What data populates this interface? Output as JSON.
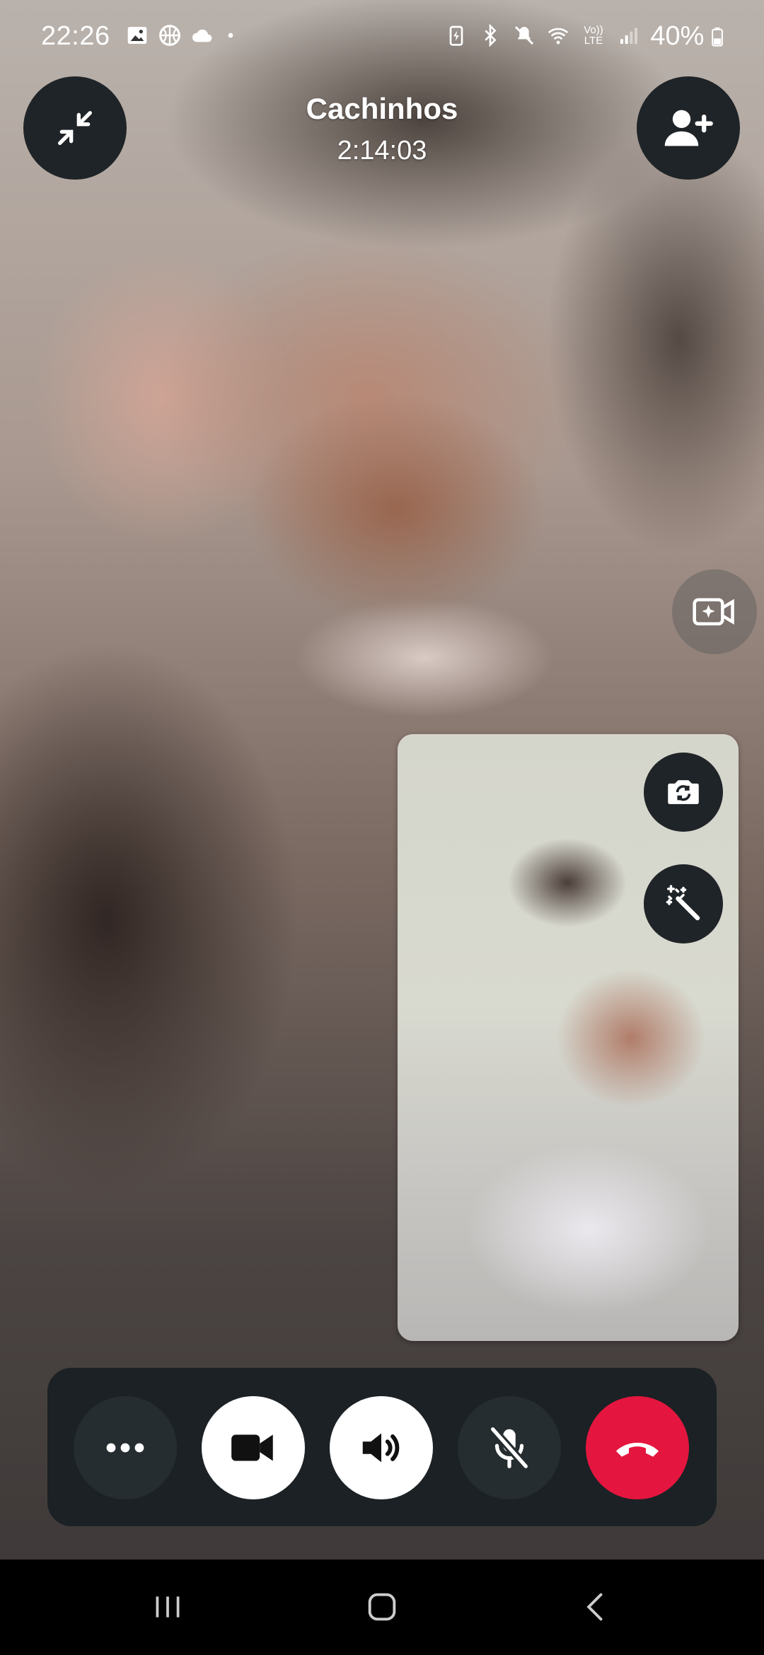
{
  "status_bar": {
    "time": "22:26",
    "battery_percent": "40%",
    "left_icons": [
      "gallery-icon",
      "basketball-icon",
      "cloud-icon",
      "dot-icon"
    ],
    "right_icons": [
      "battery-saver-icon",
      "bluetooth-icon",
      "mute-icon",
      "wifi-icon",
      "volte-icon",
      "signal-icon",
      "battery-icon"
    ],
    "volte_label": "Vo)) LTE"
  },
  "header": {
    "caller_name": "Cachinhos",
    "call_duration": "2:14:03",
    "minimize_icon": "minimize-icon",
    "add_person_icon": "add-person-icon"
  },
  "side": {
    "effects_icon": "video-effects-icon"
  },
  "self_view": {
    "flip_camera_icon": "flip-camera-icon",
    "magic_wand_icon": "magic-wand-icon"
  },
  "controls": {
    "more_icon": "more-icon",
    "video_icon": "video-camera-icon",
    "speaker_icon": "speaker-icon",
    "mic_icon": "mic-off-icon",
    "end_call_icon": "end-call-icon",
    "end_call_color": "#e4163f"
  },
  "nav_bar": {
    "recents_icon": "recents-icon",
    "home_icon": "home-icon",
    "back_icon": "back-icon"
  }
}
